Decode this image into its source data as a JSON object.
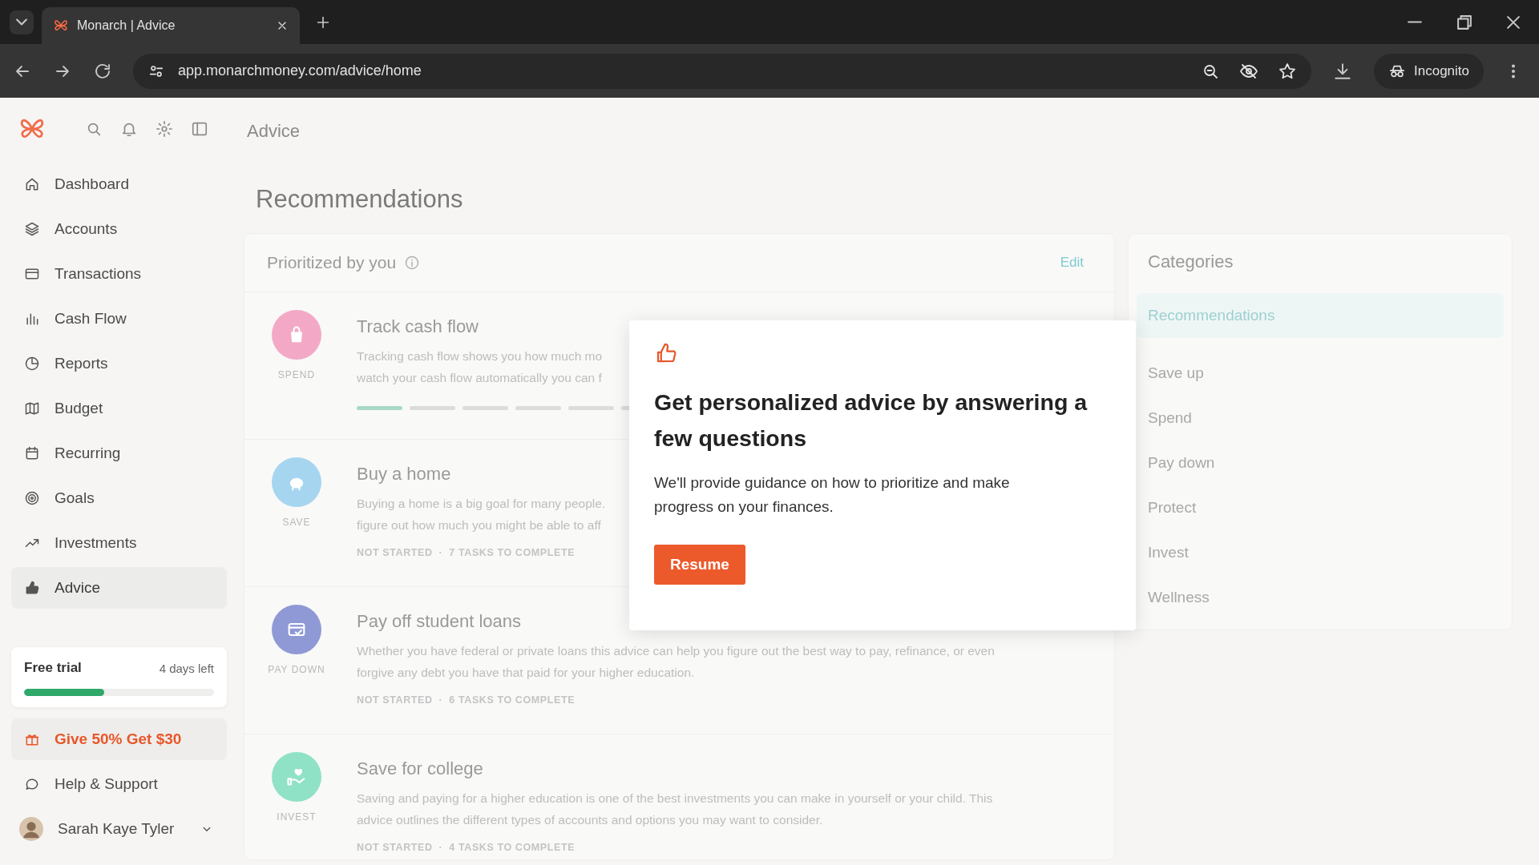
{
  "browser": {
    "tab_title": "Monarch | Advice",
    "url": "app.monarchmoney.com/advice/home",
    "profile_label": "Incognito"
  },
  "header": {
    "title": "Advice"
  },
  "sidebar": {
    "items": [
      {
        "label": "Dashboard",
        "selected": false
      },
      {
        "label": "Accounts",
        "selected": false
      },
      {
        "label": "Transactions",
        "selected": false
      },
      {
        "label": "Cash Flow",
        "selected": false
      },
      {
        "label": "Reports",
        "selected": false
      },
      {
        "label": "Budget",
        "selected": false
      },
      {
        "label": "Recurring",
        "selected": false
      },
      {
        "label": "Goals",
        "selected": false
      },
      {
        "label": "Investments",
        "selected": false
      },
      {
        "label": "Advice",
        "selected": true
      }
    ],
    "trial": {
      "label": "Free trial",
      "days_left": "4 days left",
      "level": 0.42
    },
    "referral": "Give 50% Get $30",
    "help": "Help & Support",
    "user": "Sarah Kaye Tyler"
  },
  "recommendations": {
    "heading": "Recommendations",
    "section_title": "Prioritized by you",
    "edit": "Edit",
    "cards": [
      {
        "title": "Track cash flow",
        "category": "SPEND",
        "color": "#f3a9c6",
        "description_lines": [
          "Tracking cash flow shows you how much mo",
          "watch your cash flow automatically you can f"
        ],
        "segments": [
          {
            "done": true
          },
          {
            "done": false
          },
          {
            "done": false
          },
          {
            "done": false
          },
          {
            "done": false
          },
          {
            "done": false
          }
        ]
      },
      {
        "title": "Buy a home",
        "category": "SAVE",
        "color": "#a6d5f0",
        "description_lines": [
          "Buying a home is a big goal for many people.",
          "figure out how much you might be able to aff"
        ],
        "status": "NOT STARTED",
        "separator": "·",
        "tasks": "7 TASKS TO COMPLETE"
      },
      {
        "title": "Pay off student loans",
        "category": "PAY DOWN",
        "color": "#8f99d6",
        "description_lines": [
          "Whether you have federal or private loans this advice can help you figure out the best way to pay, refinance, or even",
          "forgive any debt you have that paid for your higher education."
        ],
        "status": "NOT STARTED",
        "separator": "·",
        "tasks": "6 TASKS TO COMPLETE"
      },
      {
        "title": "Save for college",
        "category": "INVEST",
        "color": "#8fe2c6",
        "description_lines": [
          "Saving and paying for a higher education is one of the best investments you can make in yourself or your child. This",
          "advice outlines the different types of accounts and options you may want to consider."
        ],
        "status": "NOT STARTED",
        "separator": "·",
        "tasks": "4 TASKS TO COMPLETE"
      }
    ]
  },
  "categories": {
    "title": "Categories",
    "items": [
      {
        "label": "Recommendations",
        "selected": true
      },
      {
        "label": "Save up",
        "selected": false
      },
      {
        "label": "Spend",
        "selected": false
      },
      {
        "label": "Pay down",
        "selected": false
      },
      {
        "label": "Protect",
        "selected": false
      },
      {
        "label": "Invest",
        "selected": false
      },
      {
        "label": "Wellness",
        "selected": false
      }
    ]
  },
  "popup": {
    "title": "Get personalized advice by answering a few questions",
    "body": "We'll provide guidance on how to prioritize and make progress on your finances.",
    "button": "Resume"
  }
}
